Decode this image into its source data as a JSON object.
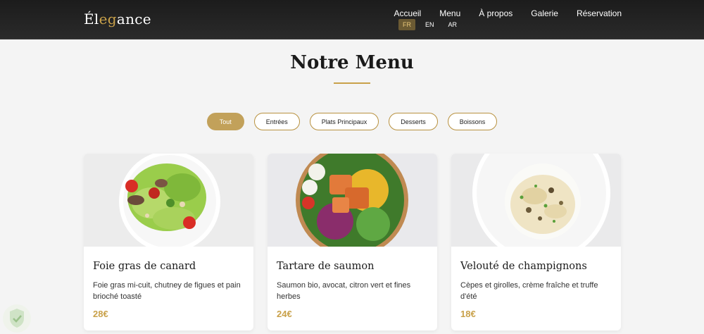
{
  "brand": {
    "logo_pre": "Él",
    "logo_accent": "eg",
    "logo_post": "ance"
  },
  "nav": {
    "items": [
      "Accueil",
      "Menu",
      "À propos",
      "Galerie",
      "Réservation"
    ]
  },
  "languages": [
    "FR",
    "EN",
    "AR"
  ],
  "active_language": "FR",
  "section": {
    "title": "Notre Menu"
  },
  "filters": [
    "Tout",
    "Entrées",
    "Plats Principaux",
    "Desserts",
    "Boissons"
  ],
  "active_filter": "Tout",
  "cards": [
    {
      "title": "Foie gras de canard",
      "description": "Foie gras mi-cuit, chutney de figues et pain brioché toasté",
      "price": "28€",
      "image": "salad-plate"
    },
    {
      "title": "Tartare de saumon",
      "description": "Saumon bio, avocat, citron vert et fines herbes",
      "price": "24€",
      "image": "salmon-bowl"
    },
    {
      "title": "Velouté de champignons",
      "description": "Cèpes et girolles, crème fraîche et truffe d'été",
      "price": "18€",
      "image": "risotto-plate"
    }
  ],
  "colors": {
    "gold": "#c9a14a",
    "nav_bg": "#1c1c1c",
    "page_bg": "#f4f4f4"
  }
}
